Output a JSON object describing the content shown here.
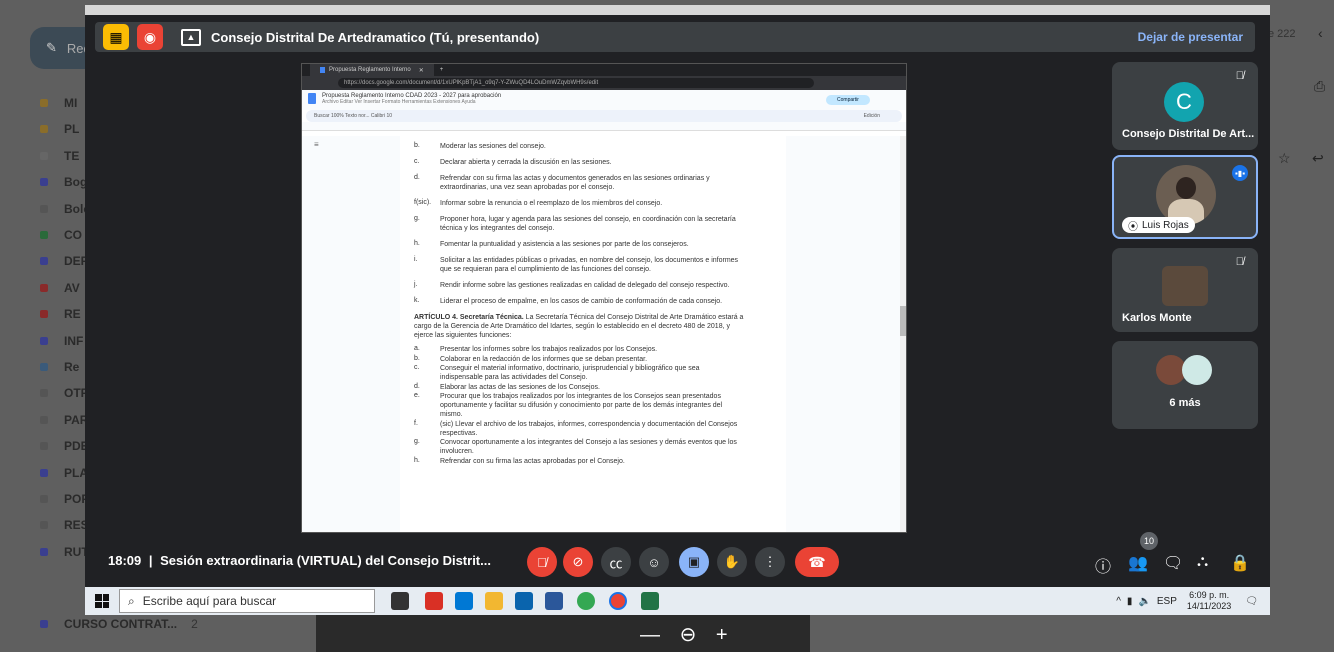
{
  "gmail": {
    "compose_label": "Red",
    "folders": [
      {
        "label": "MI",
        "color": "#8a6d2a"
      },
      {
        "label": "PL",
        "color": "#8a6d2a"
      },
      {
        "label": "TE",
        "color": "#666666"
      },
      {
        "label": "Bog",
        "color": "#3a3f8f"
      },
      {
        "label": "Bole",
        "color": "#555555"
      },
      {
        "label": "CO",
        "color": "#2a6a3a"
      },
      {
        "label": "DEF",
        "color": "#3a3f8f"
      },
      {
        "label": "AV",
        "color": "#8a2a2a"
      },
      {
        "label": "RE",
        "color": "#8a2a2a"
      },
      {
        "label": "INF",
        "color": "#3a3f8f"
      },
      {
        "label": "Re",
        "color": "#3a5a7a"
      },
      {
        "label": "OTF",
        "color": "#555555"
      },
      {
        "label": "PAR",
        "color": "#555555"
      },
      {
        "label": "PDE",
        "color": "#555555"
      },
      {
        "label": "PLA",
        "color": "#3a3f8f"
      },
      {
        "label": "POF",
        "color": "#555555"
      },
      {
        "label": "RES",
        "color": "#555555"
      },
      {
        "label": "RUT",
        "color": "#3a3f8f"
      }
    ],
    "last_folder": {
      "label": "CURSO CONTRAT...",
      "count": "2"
    },
    "pagination_tail": "e 222"
  },
  "meet": {
    "present_title": "Consejo Distrital De Artedramatico (Tú, presentando)",
    "stop_presenting": "Dejar de presentar",
    "meeting_time": "18:09",
    "meeting_name": "Sesión extraordinaria (VIRTUAL) del Consejo Distrit...",
    "participants_count": "10",
    "tiles": [
      {
        "name": "Consejo Distrital De Art...",
        "initial": "C"
      },
      {
        "name": "Luis Rojas"
      },
      {
        "name": "Karlos Monte"
      },
      {
        "name": "6 más"
      }
    ]
  },
  "shared_doc": {
    "browser_tab": "Propuesta Reglamento Interno",
    "url": "https://docs.google.com/document/d/1xUPlKpBTjA1_o9q7-Y-ZWuQD4LOuDmWZqvbWH9s/edit",
    "doc_title": "Propuesta Reglamento Interno CDAD 2023 - 2027 para aprobación",
    "menu": "Archivo  Editar  Ver  Insertar  Formato  Herramientas  Extensiones  Ayuda",
    "share_label": "Compartir",
    "toolbar_text": "Buscar    100%    Texto nor...    Calibri    10",
    "edit_mode": "Edición",
    "items_top": [
      {
        "letter": "b.",
        "text": "Moderar las sesiones del consejo."
      },
      {
        "letter": "c.",
        "text": "Declarar abierta y cerrada la discusión en las sesiones."
      },
      {
        "letter": "d.",
        "text": "Refrendar con su firma las actas y documentos generados en las sesiones ordinarias y",
        "text2": "extraordinarias, una vez sean aprobadas por el consejo."
      },
      {
        "letter": "f(sic).",
        "text": "Informar sobre la renuncia o el reemplazo de los miembros del consejo."
      },
      {
        "letter": "g.",
        "text": "Proponer hora, lugar y agenda para las sesiones del consejo, en coordinación con la secretaría",
        "text2": "técnica y los integrantes del consejo."
      },
      {
        "letter": "h.",
        "text": "Fomentar la puntualidad y asistencia a las sesiones por parte de los consejeros."
      },
      {
        "letter": "i.",
        "text": "Solicitar a las entidades públicas o privadas, en nombre del consejo, los documentos e informes",
        "text2": "que se requieran para el cumplimiento de las funciones del consejo."
      },
      {
        "letter": "j.",
        "text": "Rendir informe sobre las gestiones realizadas en calidad de delegado del consejo respectivo."
      },
      {
        "letter": "k.",
        "text": "Liderar el proceso de empalme, en los casos de cambio de conformación de cada consejo."
      }
    ],
    "article_title": "ARTÍCULO 4. Secretaría Técnica.",
    "article_text1": "La Secretaría Técnica del Consejo Distrital de Arte Dramático estará a",
    "article_text2": "cargo de la Gerencia de Arte Dramático del Idartes, según lo establecido en el decreto 480 de 2018, y",
    "article_text3": "ejerce las siguientes funciones:",
    "items_bottom": [
      {
        "letter": "a.",
        "text": "Presentar los informes sobre los trabajos realizados por los Consejos."
      },
      {
        "letter": "b.",
        "text": "Colaborar en la redacción de los informes que se deban presentar."
      },
      {
        "letter": "c.",
        "text": "Conseguir el material informativo, doctrinario, jurisprudencial y bibliográfico que sea",
        "text2": "indispensable para las actividades del Consejo."
      },
      {
        "letter": "d.",
        "text": "Elaborar las actas de las sesiones de los Consejos."
      },
      {
        "letter": "e.",
        "text": "Procurar que los trabajos realizados por los integrantes de los Consejos sean presentados",
        "text2": "oportunamente y facilitar su difusión y conocimiento por parte de los demás integrantes del",
        "text3": "mismo."
      },
      {
        "letter": "f.",
        "text": "(sic) Llevar el archivo de los trabajos, informes, correspondencia y documentación del Consejos",
        "text2": "respectivas."
      },
      {
        "letter": "g.",
        "text": "Convocar oportunamente a los integrantes del Consejo a las sesiones y demás eventos que los",
        "text2": "involucren."
      },
      {
        "letter": "h.",
        "text": "Refrendar con su firma las actas aprobadas por el Consejo."
      }
    ]
  },
  "taskbar": {
    "search_placeholder": "Escribe aquí para buscar",
    "language": "ESP",
    "time": "6:09 p. m.",
    "date": "14/11/2023"
  }
}
